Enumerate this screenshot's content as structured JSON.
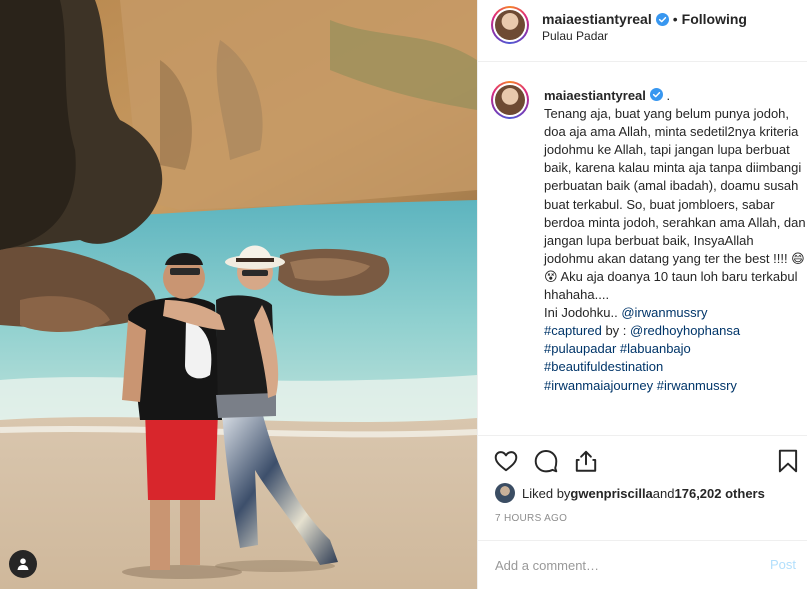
{
  "post": {
    "author": "maiaestiantyreal",
    "follow_status": "Following",
    "dot": "•",
    "location": "Pulau Padar"
  },
  "caption": {
    "author": "maiaestiantyreal",
    "suffix": " .",
    "body": "Tenang aja, buat yang belum punya jodoh, doa aja ama Allah, minta sedetil2nya kriteria jodohmu ke Allah, tapi jangan lupa berbuat baik, karena kalau minta aja tanpa diimbangi perbuatan baik (amal ibadah), doamu susah buat terkabul. So, buat jombloers, sabar berdoa minta jodoh, serahkan ama Allah, dan jangan lupa berbuat baik, InsyaAllah jodohmu akan datang yang ter the best !!!! 😄😵 Aku aja doanya 10 taun loh baru terkabul hhahaha....",
    "line_jodohku_prefix": "Ini Jodohku.. ",
    "mention_irwan": "@irwanmussry",
    "hashtag_captured": "#captured",
    "captured_by": " by : ",
    "mention_redhoy": "@redhoyhophansa",
    "hashtag_pulaupadar": "#pulaupadar",
    "hashtag_labuanbajo": "#labuanbajo",
    "hashtag_beautiful": "#beautifuldestination",
    "hashtag_journey": "#irwanmaiajourney",
    "hashtag_irwan": "#irwanmussry"
  },
  "engagement": {
    "liked_by_prefix": "Liked by ",
    "liked_by_user": "gwenpriscilla",
    "and_text": " and ",
    "others": "176,202 others",
    "time": "7 HOURS AGO"
  },
  "comment_box": {
    "placeholder": "Add a comment…",
    "post_label": "Post"
  },
  "icons": {
    "tag": "user-tag-icon",
    "like": "heart-icon",
    "comment": "comment-bubble-icon",
    "share": "share-icon",
    "save": "bookmark-icon",
    "verified": "verified-badge-icon"
  },
  "colors": {
    "link": "#003569",
    "verified": "#3897f0",
    "muted": "#8e8e8e",
    "post_disabled": "#b2dffc"
  }
}
